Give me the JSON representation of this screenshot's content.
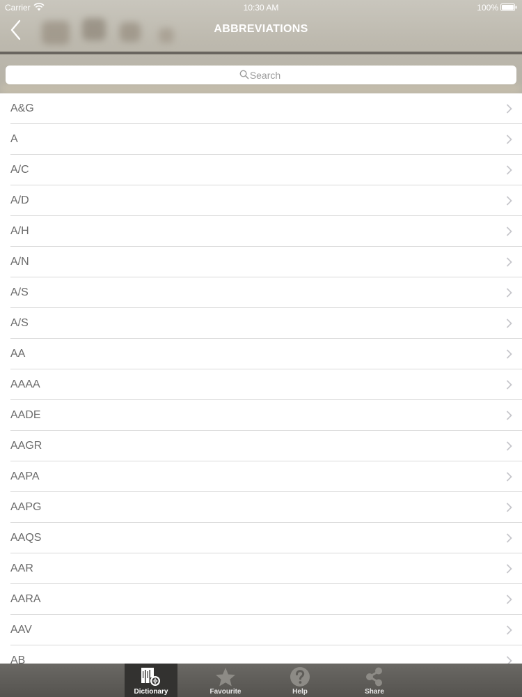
{
  "status_bar": {
    "carrier": "Carrier",
    "time": "10:30 AM",
    "battery": "100%"
  },
  "nav": {
    "title": "ABBREVIATIONS",
    "back_icon": "chevron-left-icon"
  },
  "search": {
    "placeholder": "Search",
    "value": ""
  },
  "list": {
    "items": [
      {
        "label": "A&G"
      },
      {
        "label": "A"
      },
      {
        "label": "A/C"
      },
      {
        "label": "A/D"
      },
      {
        "label": "A/H"
      },
      {
        "label": "A/N"
      },
      {
        "label": "A/S"
      },
      {
        "label": "A/S"
      },
      {
        "label": "AA"
      },
      {
        "label": "AAAA"
      },
      {
        "label": "AADE"
      },
      {
        "label": "AAGR"
      },
      {
        "label": "AAPA"
      },
      {
        "label": "AAPG"
      },
      {
        "label": "AAQS"
      },
      {
        "label": "AAR"
      },
      {
        "label": "AARA"
      },
      {
        "label": "AAV"
      },
      {
        "label": "AB"
      }
    ]
  },
  "tab_bar": {
    "tabs": [
      {
        "label": "Dictionary",
        "icon": "dictionary-icon",
        "active": true
      },
      {
        "label": "Favourite",
        "icon": "star-icon",
        "active": false
      },
      {
        "label": "Help",
        "icon": "help-icon",
        "active": false
      },
      {
        "label": "Share",
        "icon": "share-icon",
        "active": false
      }
    ]
  },
  "colors": {
    "header_bg": "#bdb9ae",
    "tab_bar_bg": "#5e5c58",
    "tab_active_bg": "#333230",
    "row_text": "#6b6b6b",
    "separator": "#d9d9d9"
  }
}
